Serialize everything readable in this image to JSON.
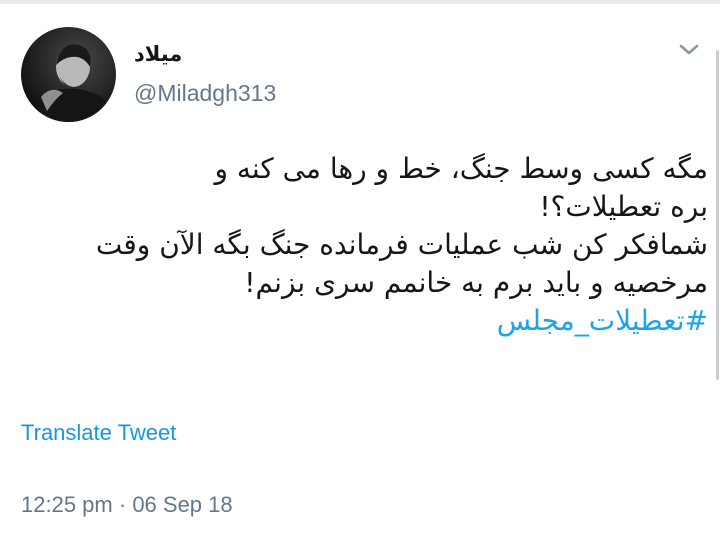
{
  "tweet": {
    "author": {
      "display_name": "میلاد",
      "username": "@Miladgh313",
      "avatar_icon": "profile-photo"
    },
    "menu_icon": "chevron-down-icon",
    "text_lines": [
      "مگه کسی وسط جنگ، خط و رها می کنه و",
      "بره تعطیلات؟!",
      "شمافکر کن شب عملیات فرمانده جنگ بگه الآن وقت",
      "مرخصیه و باید برم به خانمم سری بزنم!"
    ],
    "hashtag": "#تعطیلات_مجلس",
    "translate_label": "Translate Tweet",
    "time": "12:25 pm",
    "separator": "·",
    "date": "06 Sep 18"
  },
  "colors": {
    "text": "#14171a",
    "muted": "#657786",
    "link": "#1da1f2",
    "translate": "#1b95e0"
  }
}
